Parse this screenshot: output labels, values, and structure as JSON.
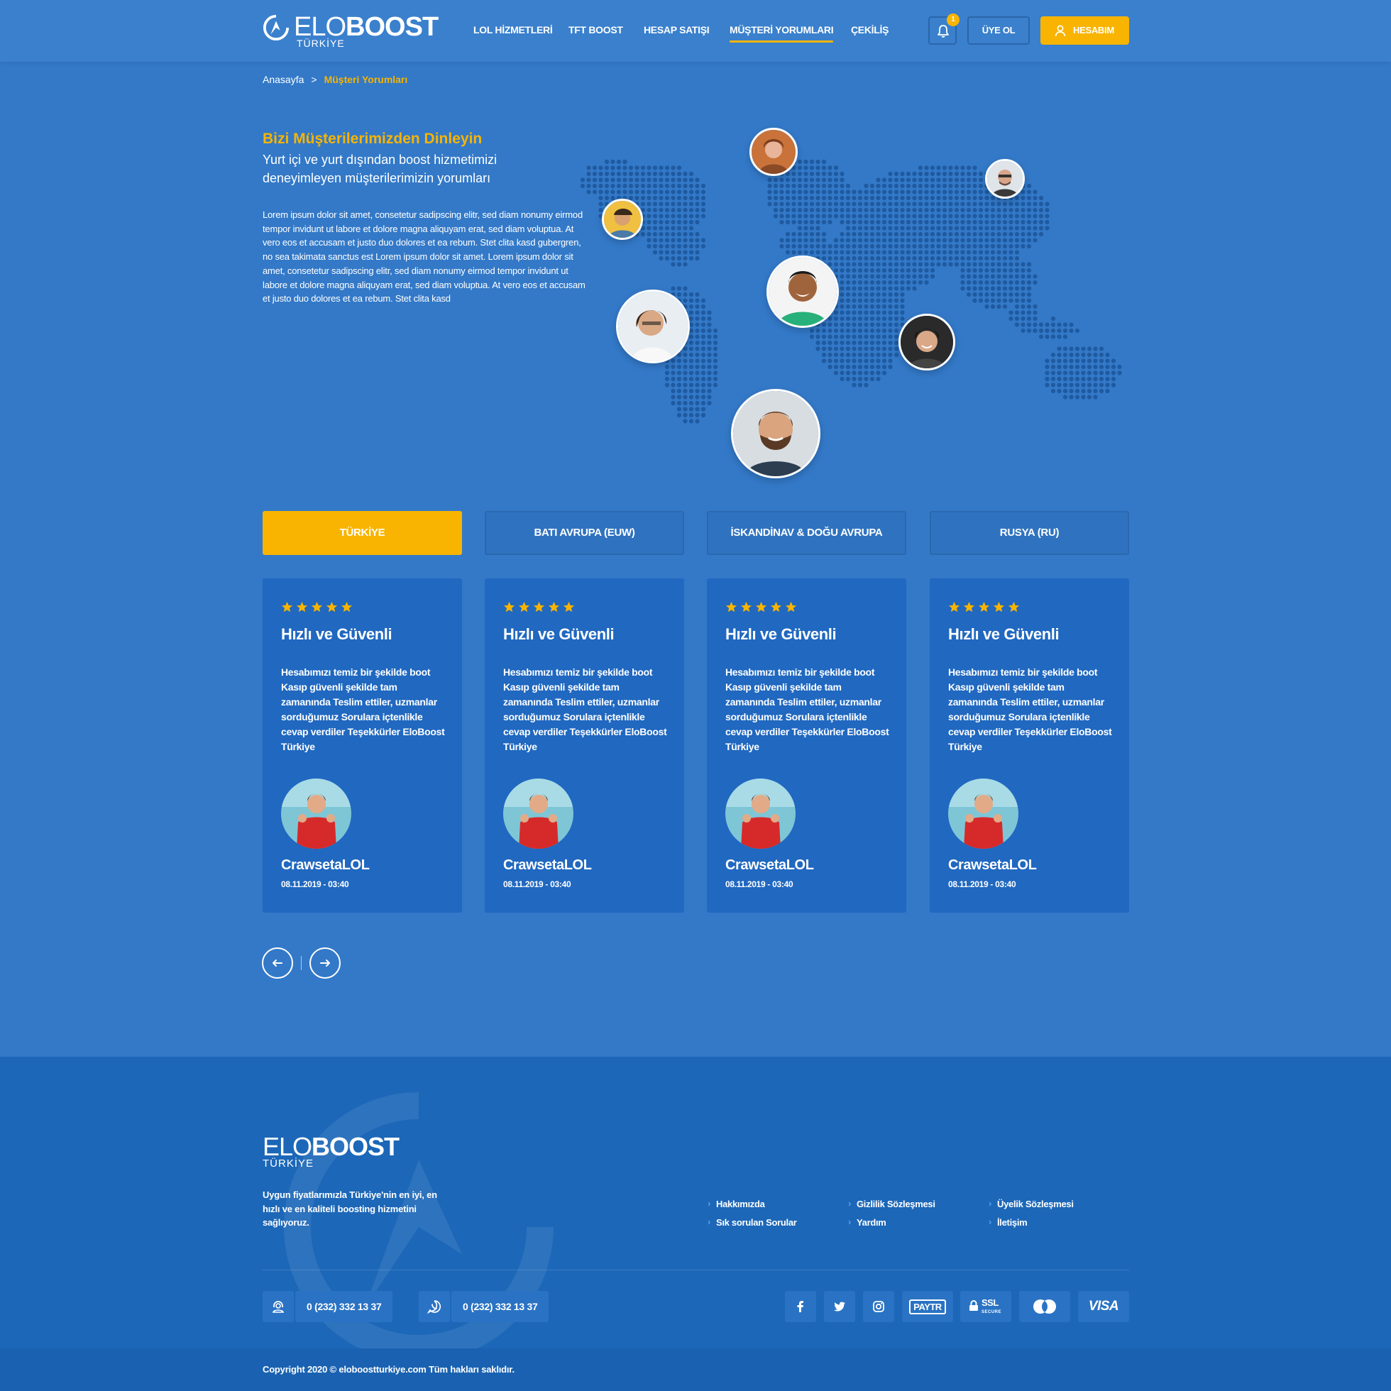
{
  "brand": {
    "name_light": "ELO",
    "name_bold": "BOOST",
    "sub": "TÜRKİYE",
    "accent_color": "#f8b400",
    "background_color": "#3379c8"
  },
  "nav": {
    "items": [
      {
        "label": "LOL HİZMETLERİ"
      },
      {
        "label": "TFT BOOST"
      },
      {
        "label": "HESAP SATIŞI"
      },
      {
        "label": "MÜŞTERİ YORUMLARI",
        "active": true
      },
      {
        "label": "ÇEKİLİŞ"
      }
    ],
    "notification_count": "1",
    "signup_label": "ÜYE OL",
    "account_label": "HESABIM"
  },
  "breadcrumb": {
    "home": "Anasayfa",
    "separator": ">",
    "current": "Müşteri Yorumları"
  },
  "hero": {
    "title": "Bizi Müşterilerimizden Dinleyin",
    "subtitle": "Yurt içi ve yurt dışından boost hizmetimizi deneyimleyen müşterilerimizin yorumları",
    "body": "Lorem ipsum dolor sit amet, consetetur sadipscing elitr, sed diam nonumy eirmod tempor invidunt ut labore et dolore magna aliquyam erat, sed diam voluptua. At vero eos et accusam et justo duo dolores et ea rebum. Stet clita kasd gubergren, no sea takimata sanctus est Lorem ipsum dolor sit amet. Lorem ipsum dolor sit amet, consetetur sadipscing elitr, sed diam nonumy eirmod tempor invidunt ut labore et dolore magna aliquyam erat, sed diam voluptua. At vero eos et accusam et justo duo dolores et ea rebum. Stet clita kasd"
  },
  "tabs": [
    {
      "label": "TÜRKİYE",
      "active": true
    },
    {
      "label": "BATI AVRUPA (EUW)"
    },
    {
      "label": "İSKANDİNAV & DOĞU AVRUPA"
    },
    {
      "label": "RUSYA (RU)"
    }
  ],
  "reviews": [
    {
      "rating": 5,
      "title": "Hızlı ve Güvenli",
      "text": "Hesabımızı temiz bir şekilde boot Kasıp güvenli şekilde tam zamanında Teslim ettiler, uzmanlar sorduğumuz Sorulara içtenlikle cevap verdiler Teşekkürler EloBoost Türkiye",
      "name": "CrawsetaLOL",
      "date": "08.11.2019 - 03:40"
    },
    {
      "rating": 5,
      "title": "Hızlı ve Güvenli",
      "text": "Hesabımızı temiz bir şekilde boot Kasıp güvenli şekilde tam zamanında Teslim ettiler, uzmanlar sorduğumuz Sorulara içtenlikle cevap verdiler Teşekkürler EloBoost Türkiye",
      "name": "CrawsetaLOL",
      "date": "08.11.2019 - 03:40"
    },
    {
      "rating": 5,
      "title": "Hızlı ve Güvenli",
      "text": "Hesabımızı temiz bir şekilde boot Kasıp güvenli şekilde tam zamanında Teslim ettiler, uzmanlar sorduğumuz Sorulara içtenlikle cevap verdiler Teşekkürler EloBoost Türkiye",
      "name": "CrawsetaLOL",
      "date": "08.11.2019 - 03:40"
    },
    {
      "rating": 5,
      "title": "Hızlı ve Güvenli",
      "text": "Hesabımızı temiz bir şekilde boot Kasıp güvenli şekilde tam zamanında Teslim ettiler, uzmanlar sorduğumuz Sorulara içtenlikle cevap verdiler Teşekkürler EloBoost Türkiye",
      "name": "CrawsetaLOL",
      "date": "08.11.2019 - 03:40"
    }
  ],
  "pager": {
    "prev_icon": "arrow-left-icon",
    "next_icon": "arrow-right-icon"
  },
  "footer": {
    "description": "Uygun fiyatlarımızla Türkiye'nin en iyi, en hızlı ve en kaliteli boosting hizmetini sağlıyoruz.",
    "links": [
      {
        "label": "Hakkımızda"
      },
      {
        "label": "Gizlilik Sözleşmesi"
      },
      {
        "label": "Üyelik Sözleşmesi"
      },
      {
        "label": "Sık sorulan Sorular"
      },
      {
        "label": "Yardım"
      },
      {
        "label": "İletişim"
      }
    ],
    "phone": "0 (232) 332 13 37",
    "whatsapp": "0 (232) 332 13 37",
    "social": [
      "facebook-icon",
      "twitter-icon",
      "instagram-icon"
    ],
    "payments": {
      "paytr": "PAYTR",
      "ssl": "SSL",
      "ssl_sub": "SECURE",
      "visa": "VISA"
    },
    "copyright": "Copyright 2020 © eloboostturkiye.com Tüm hakları saklıdır."
  }
}
